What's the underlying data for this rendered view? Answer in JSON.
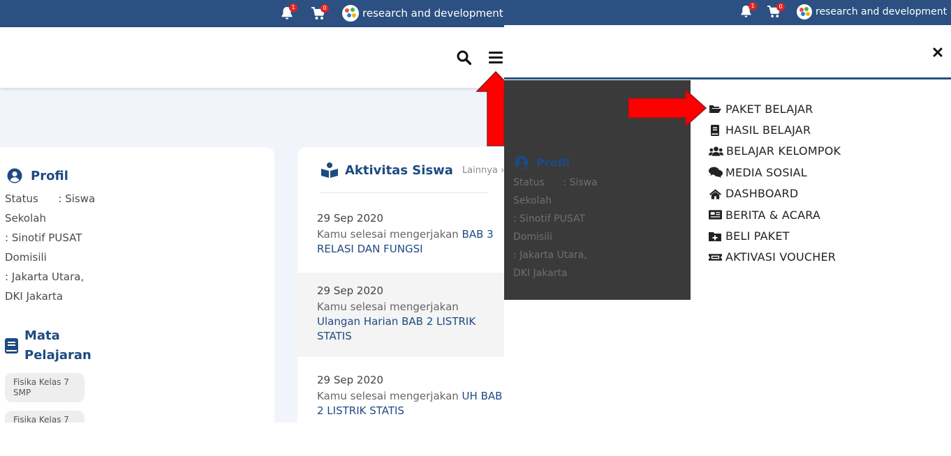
{
  "topbar": {
    "notif_count": "1",
    "cart_count": "0",
    "user_name": "research and development"
  },
  "profile": {
    "title": "Profil",
    "status": "Status      : Siswa",
    "sekolah_label": "Sekolah",
    "sekolah_value": ": Sinotif PUSAT",
    "domisili_label": "Domisili",
    "domisili_value1": ": Jakarta Utara,",
    "domisili_value2": "DKI Jakarta"
  },
  "subjects": {
    "title_line1": "Mata",
    "title_line2": "Pelajaran",
    "items": [
      "Fisika Kelas 7 SMP",
      "Fisika Kelas 7"
    ]
  },
  "activity": {
    "title": "Aktivitas Siswa",
    "more": "Lainnya",
    "items": [
      {
        "date": "29 Sep 2020",
        "prefix": "Kamu selesai mengerjakan ",
        "subject": "BAB 3 RELASI DAN FUNGSI"
      },
      {
        "date": "29 Sep 2020",
        "prefix": "Kamu selesai mengerjakan ",
        "subject": "Ulangan Harian BAB 2 LISTRIK STATIS"
      },
      {
        "date": "29 Sep 2020",
        "prefix": "Kamu selesai mengerjakan ",
        "subject": "UH BAB 2 LISTRIK STATIS"
      }
    ]
  },
  "overlay_profile": {
    "title": "Profil",
    "status": "Status      : Siswa",
    "sekolah_label": "Sekolah",
    "sekolah_value": ": Sinotif PUSAT",
    "domisili_label": "Domisili",
    "domisili_value1": ": Jakarta Utara,",
    "domisili_value2": "DKI Jakarta"
  },
  "menu": {
    "items": [
      {
        "label": "PAKET BELAJAR",
        "icon": "folder-open-icon"
      },
      {
        "label": "HASIL BELAJAR",
        "icon": "book-icon"
      },
      {
        "label": "BELAJAR KELOMPOK",
        "icon": "users-icon"
      },
      {
        "label": "MEDIA SOSIAL",
        "icon": "comments-icon"
      },
      {
        "label": "DASHBOARD",
        "icon": "home-icon"
      },
      {
        "label": "BERITA & ACARA",
        "icon": "newspaper-icon"
      },
      {
        "label": "BELI PAKET",
        "icon": "folder-plus-icon"
      },
      {
        "label": "AKTIVASI VOUCHER",
        "icon": "ticket-icon"
      }
    ]
  },
  "colors": {
    "brand": "#2b5081",
    "heading": "#1e4a82",
    "badge": "#e02424",
    "arrow": "#ff0000"
  }
}
